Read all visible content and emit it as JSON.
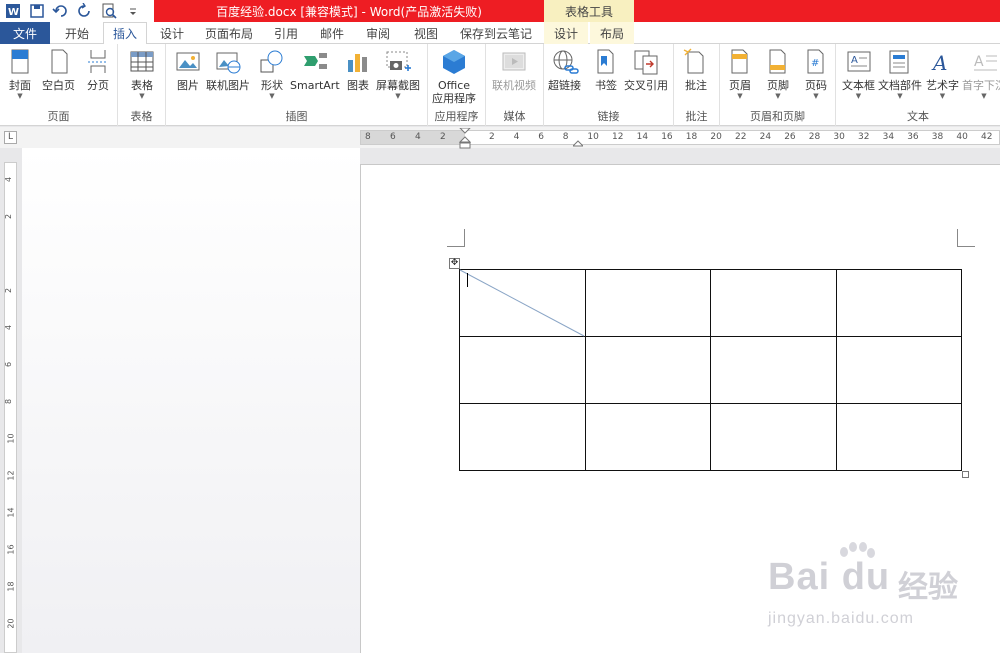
{
  "quick_access": {
    "icons": [
      "word-icon",
      "save-icon",
      "undo-icon",
      "redo-icon",
      "print-preview-icon",
      "customize-icon"
    ]
  },
  "title": {
    "window_title": "百度经验.docx [兼容模式] - Word(产品激活失败)",
    "context_tools_label": "表格工具"
  },
  "tabs": {
    "file": "文件",
    "home": "开始",
    "insert": "插入",
    "design": "设计",
    "layout": "页面布局",
    "references": "引用",
    "mailings": "邮件",
    "review": "审阅",
    "view": "视图",
    "cloud": "保存到云笔记",
    "table_design": "设计",
    "table_layout": "布局"
  },
  "ribbon": {
    "pages": {
      "label": "页面",
      "cover": "封面",
      "blank": "空白页",
      "break": "分页"
    },
    "tables": {
      "label": "表格",
      "table": "表格"
    },
    "illustrations": {
      "label": "插图",
      "picture": "图片",
      "online_picture": "联机图片",
      "shapes": "形状",
      "smartart": "SmartArt",
      "chart": "图表",
      "screenshot": "屏幕截图"
    },
    "apps": {
      "label": "应用程序",
      "office_line1": "Office",
      "office_line2": "应用程序"
    },
    "media": {
      "label": "媒体",
      "online_video": "联机视频"
    },
    "links": {
      "label": "链接",
      "hyperlink": "超链接",
      "bookmark": "书签",
      "crossref": "交叉引用"
    },
    "comments": {
      "label": "批注",
      "comment": "批注"
    },
    "header_footer": {
      "label": "页眉和页脚",
      "header": "页眉",
      "footer": "页脚",
      "page_number": "页码"
    },
    "text": {
      "label": "文本",
      "textbox": "文本框",
      "quickparts": "文档部件",
      "wordart": "艺术字",
      "dropcap": "首字下沉"
    }
  },
  "ruler": {
    "corner": "L",
    "left_ticks": [
      "8",
      "6",
      "4",
      "2"
    ],
    "right_ticks": [
      "2",
      "4",
      "6",
      "8",
      "10",
      "12",
      "14",
      "16",
      "18",
      "20",
      "22",
      "24",
      "26",
      "28",
      "30",
      "32",
      "34",
      "36",
      "38",
      "40",
      "42"
    ],
    "vertical_ticks": [
      "4",
      "2",
      "",
      "2",
      "4",
      "6",
      "8",
      "10",
      "12",
      "14",
      "16",
      "18",
      "20"
    ]
  },
  "document": {
    "table_rows": 3,
    "table_cols": 4,
    "table_move_glyph": "✥"
  },
  "watermark": {
    "brand": "Bai du",
    "cn": "经验",
    "url": "jingyan.baidu.com"
  }
}
